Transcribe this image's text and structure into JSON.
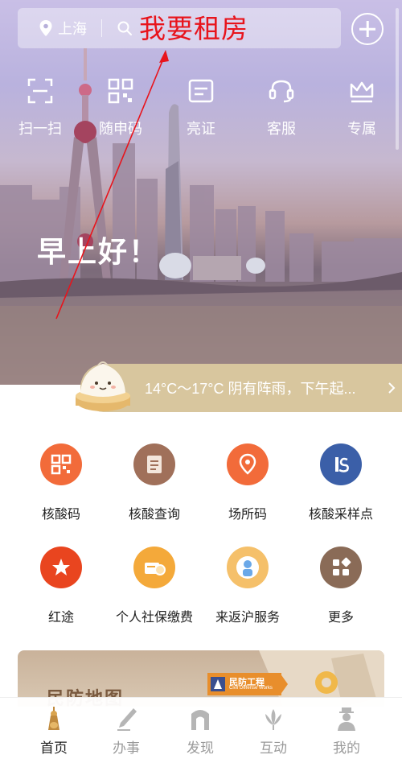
{
  "search": {
    "city": "上海",
    "query": "我要租房",
    "icons": [
      "location-pin-icon",
      "search-icon",
      "plus-circle-icon"
    ]
  },
  "quick_actions": [
    {
      "label": "扫一扫",
      "icon": "scan-icon"
    },
    {
      "label": "随申码",
      "icon": "qr-code-icon"
    },
    {
      "label": "亮证",
      "icon": "id-card-icon"
    },
    {
      "label": "客服",
      "icon": "customer-service-icon"
    },
    {
      "label": "专属",
      "icon": "crown-icon"
    }
  ],
  "greeting": "早上好！",
  "weather": {
    "text": "14°C～17°C  阴有阵雨，下午起..."
  },
  "services": [
    {
      "label": "核酸码",
      "icon": "qr-code-icon",
      "color": "#f26b3a"
    },
    {
      "label": "核酸查询",
      "icon": "document-icon",
      "color": "#a0705a"
    },
    {
      "label": "场所码",
      "icon": "location-pin-icon",
      "color": "#f26b3a"
    },
    {
      "label": "核酸采样点",
      "icon": "sampling-site-icon",
      "color": "#3b5fa8"
    },
    {
      "label": "红途",
      "icon": "star-icon",
      "color": "#e9451f"
    },
    {
      "label": "个人社保缴费",
      "icon": "social-security-icon",
      "color": "#f4a93a"
    },
    {
      "label": "来返沪服务",
      "icon": "mascot-icon",
      "color": "#f5c06a"
    },
    {
      "label": "更多",
      "icon": "grid-more-icon",
      "color": "#8a6b57"
    }
  ],
  "banner": {
    "title": "民防地图",
    "tag": "民防工程",
    "tag_sub": "Civil Defense Works"
  },
  "tabs": [
    {
      "label": "首页",
      "icon": "home-icon",
      "active": true
    },
    {
      "label": "办事",
      "icon": "pen-icon",
      "active": false
    },
    {
      "label": "发现",
      "icon": "arch-icon",
      "active": false
    },
    {
      "label": "互动",
      "icon": "magnolia-icon",
      "active": false
    },
    {
      "label": "我的",
      "icon": "person-icon",
      "active": false
    }
  ]
}
